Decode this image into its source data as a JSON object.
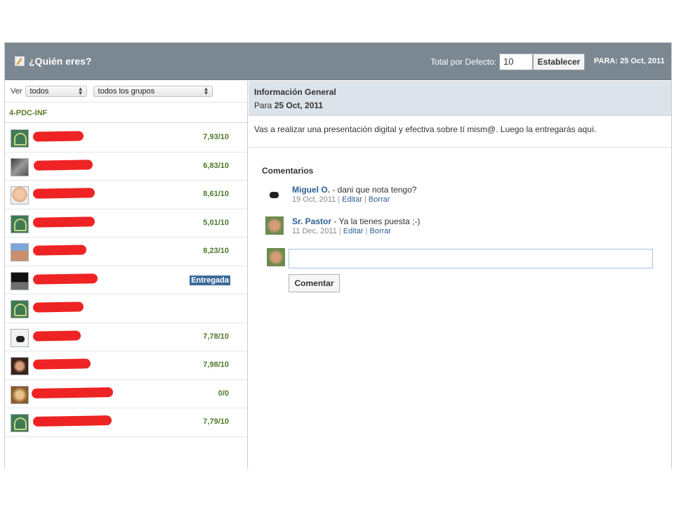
{
  "header": {
    "title": "¿Quién eres?",
    "total_label": "Total por Defecto:",
    "total_value": "10",
    "establecer_label": "Establecer",
    "para_date": "PARA: 25 Oct, 2011",
    "color": "#7b8791"
  },
  "filters": {
    "ver_label": "Ver",
    "ver_value": "todos",
    "group_value": "todos los grupos"
  },
  "group_label": "4-PDC-INF",
  "students": [
    {
      "avatar": "default-avatar-icon",
      "score": "7,93/10"
    },
    {
      "avatar": "wolf-avatar",
      "score": "6,83/10"
    },
    {
      "avatar": "baby-avatar",
      "score": "8,61/10"
    },
    {
      "avatar": "default-avatar-icon",
      "score": "5,01/10"
    },
    {
      "avatar": "person-avatar",
      "score": "8,23/10"
    },
    {
      "avatar": "dark-avatar",
      "badge": "Entregada"
    },
    {
      "avatar": "default-avatar-icon",
      "score": ""
    },
    {
      "avatar": "dog-avatar",
      "score": "7,78/10"
    },
    {
      "avatar": "woman-avatar",
      "score": "7,98/10"
    },
    {
      "avatar": "cake-avatar",
      "score": "0/0"
    },
    {
      "avatar": "default-avatar-icon",
      "score": "7,79/10"
    }
  ],
  "info": {
    "title": "Información General",
    "para_prefix": "Para",
    "para_date": "25 Oct, 2011",
    "description": "Vas a realizar una presentación digital y efectiva sobre tí mism@. Luego la entregarás aquí."
  },
  "comments": {
    "title": "Comentarios",
    "items": [
      {
        "author": "Miguel O.",
        "text": " - dani que nota tengo?",
        "date": "19 Oct, 2011",
        "edit": "Editar",
        "delete": "Borrar"
      },
      {
        "author": "Sr. Pastor",
        "text": " - Ya la tienes puesta ;-)",
        "date": "11 Dec, 2011",
        "edit": "Editar",
        "delete": "Borrar"
      }
    ],
    "input_value": "",
    "submit_label": "Comentar"
  },
  "colors": {
    "score_green": "#4a7b2a",
    "link_blue": "#2c5d94",
    "badge_blue": "#3c6a9a",
    "redaction_red": "#ee2323"
  }
}
